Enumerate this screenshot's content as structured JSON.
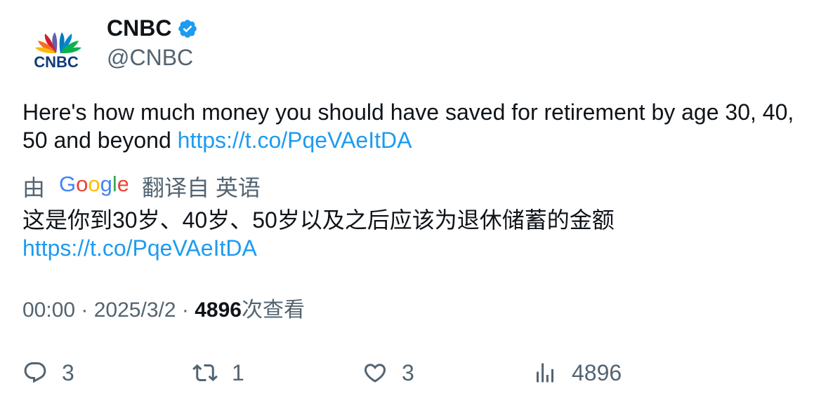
{
  "author": {
    "display_name": "CNBC",
    "handle": "@CNBC",
    "verified": true,
    "avatar_logo_text": "CNBC",
    "verified_color": "#1d9bf0"
  },
  "tweet": {
    "text": "Here's how much money you should have saved for retirement by age 30, 40, 50 and beyond ",
    "link": "https://t.co/PqeVAeItDA"
  },
  "translation": {
    "prefix": "由",
    "provider_icon": "google-logo",
    "suffix": "翻译自 英语",
    "text": "这是你到30岁、40岁、50岁以及之后应该为退休储蓄的金额",
    "link": "https://t.co/PqeVAeItDA"
  },
  "meta": {
    "time": "00:00",
    "separator": " · ",
    "date": "2025/3/2",
    "views_count": "4896",
    "views_label": "次查看"
  },
  "actions": {
    "replies": "3",
    "retweets": "1",
    "likes": "3",
    "views": "4896"
  },
  "colors": {
    "text": "#0f1419",
    "secondary": "#536471",
    "link": "#1d9bf0"
  }
}
